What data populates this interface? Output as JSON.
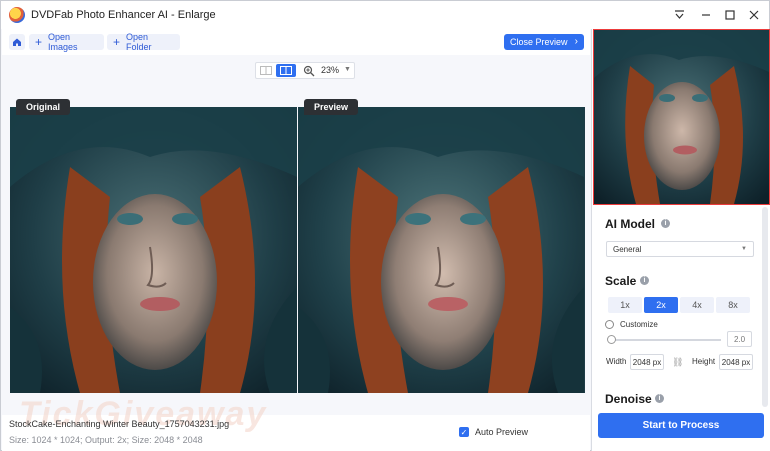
{
  "window": {
    "title": "DVDFab Photo Enhancer AI - Enlarge"
  },
  "toolbar": {
    "open_images_label": "Open Images",
    "open_folder_label": "Open Folder",
    "close_preview_label": "Close Preview"
  },
  "view": {
    "zoom_label": "23%"
  },
  "panes": {
    "original_label": "Original",
    "preview_label": "Preview"
  },
  "file": {
    "name": "StockCake-Enchanting Winter Beauty_1757043231.jpg",
    "details": "Size: 1024 * 1024; Output: 2x; Size: 2048 * 2048"
  },
  "watermark": "TickGiveaway",
  "auto_preview_label": "Auto Preview",
  "auto_preview_checked": true,
  "side": {
    "ai_model_title": "AI Model",
    "ai_model_value": "General",
    "scale_title": "Scale",
    "scale_options": [
      "1x",
      "2x",
      "4x",
      "8x"
    ],
    "scale_selected": "2x",
    "customize_label": "Customize",
    "custom_value": "2.0",
    "width_label": "Width",
    "width_value": "2048 px",
    "height_label": "Height",
    "height_value": "2048 px",
    "denoise_title": "Denoise",
    "start_label": "Start to Process"
  },
  "colors": {
    "accent": "#2f6ff0",
    "thumb_border": "#ec3b3b"
  }
}
